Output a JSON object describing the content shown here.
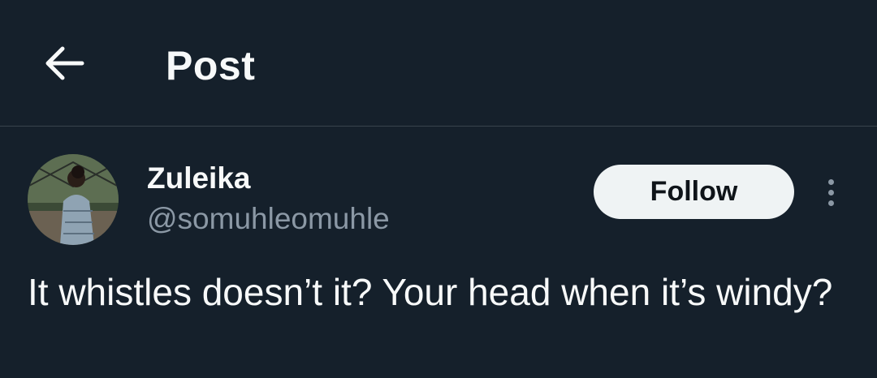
{
  "header": {
    "back_icon": "arrow-left-icon",
    "title": "Post"
  },
  "post": {
    "author": {
      "display_name": "Zuleika",
      "handle": "@somuhleomuhle",
      "avatar_icon": "profile-photo"
    },
    "follow_label": "Follow",
    "more_icon": "more-vertical-icon",
    "text": "It whistles doesn’t it? Your head when it’s windy?"
  },
  "colors": {
    "background": "#15202b",
    "text_primary": "#f7f9f9",
    "text_secondary": "#8b98a5",
    "divider": "#38444d",
    "follow_bg": "#eff3f4",
    "follow_text": "#0f1419"
  }
}
